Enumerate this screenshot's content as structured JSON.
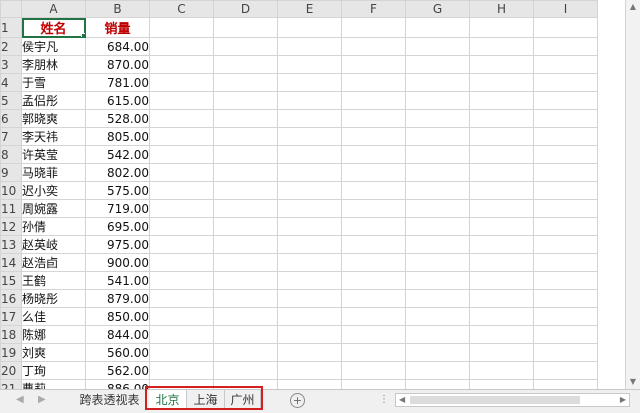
{
  "columns": [
    "A",
    "B",
    "C",
    "D",
    "E",
    "F",
    "G",
    "H",
    "I"
  ],
  "header_row": {
    "row": "1",
    "name": "姓名",
    "sales": "销量"
  },
  "rows": [
    {
      "row": "2",
      "name": "侯宇凡",
      "sales": "684.00"
    },
    {
      "row": "3",
      "name": "李朋林",
      "sales": "870.00"
    },
    {
      "row": "4",
      "name": "于雪",
      "sales": "781.00"
    },
    {
      "row": "5",
      "name": "孟侣彤",
      "sales": "615.00"
    },
    {
      "row": "6",
      "name": "郭晓爽",
      "sales": "528.00"
    },
    {
      "row": "7",
      "name": "李天祎",
      "sales": "805.00"
    },
    {
      "row": "8",
      "name": "许英莹",
      "sales": "542.00"
    },
    {
      "row": "9",
      "name": "马晓菲",
      "sales": "802.00"
    },
    {
      "row": "10",
      "name": "迟小奕",
      "sales": "575.00"
    },
    {
      "row": "11",
      "name": "周婉露",
      "sales": "719.00"
    },
    {
      "row": "12",
      "name": "孙倩",
      "sales": "695.00"
    },
    {
      "row": "13",
      "name": "赵英岐",
      "sales": "975.00"
    },
    {
      "row": "14",
      "name": "赵浩卣",
      "sales": "900.00"
    },
    {
      "row": "15",
      "name": "王鹤",
      "sales": "541.00"
    },
    {
      "row": "16",
      "name": "杨晓彤",
      "sales": "879.00"
    },
    {
      "row": "17",
      "name": "么佳",
      "sales": "850.00"
    },
    {
      "row": "18",
      "name": "陈娜",
      "sales": "844.00"
    },
    {
      "row": "19",
      "name": "刘爽",
      "sales": "560.00"
    },
    {
      "row": "20",
      "name": "丁珣",
      "sales": "562.00"
    },
    {
      "row": "21",
      "name": "曹莉",
      "sales": "886.00"
    }
  ],
  "sheet_tabs": [
    {
      "label": "跨表透视表",
      "active": false
    },
    {
      "label": "北京",
      "active": true
    },
    {
      "label": "上海",
      "active": false
    },
    {
      "label": "广州",
      "active": false
    }
  ],
  "add_sheet_symbol": "+",
  "colors": {
    "header_text": "#c00000",
    "accent": "#217346",
    "highlight_box": "#d21f1f"
  }
}
